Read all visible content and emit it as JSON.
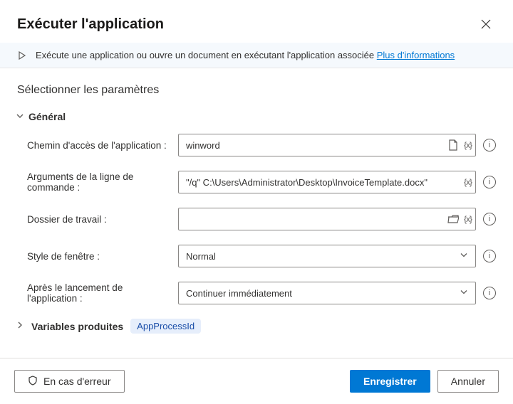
{
  "header": {
    "title": "Exécuter l'application"
  },
  "info": {
    "text": "Exécute une application ou ouvre un document en exécutant l'application associée ",
    "link": "Plus d'informations"
  },
  "section_title": "Sélectionner les paramètres",
  "general_label": "Général",
  "fields": {
    "app_path": {
      "label": "Chemin d'accès de l'application :",
      "value": "winword"
    },
    "cmd_args": {
      "label": "Arguments de la ligne de commande :",
      "value": "\"/q\" C:\\Users\\Administrator\\Desktop\\InvoiceTemplate.docx\""
    },
    "work_dir": {
      "label": "Dossier de travail :",
      "value": ""
    },
    "window_style": {
      "label": "Style de fenêtre :",
      "value": "Normal"
    },
    "after_launch": {
      "label": "Après le lancement de l'application :",
      "value": "Continuer immédiatement"
    }
  },
  "vars": {
    "label": "Variables produites",
    "chip": "AppProcessId"
  },
  "footer": {
    "on_error": "En cas d'erreur",
    "save": "Enregistrer",
    "cancel": "Annuler"
  }
}
